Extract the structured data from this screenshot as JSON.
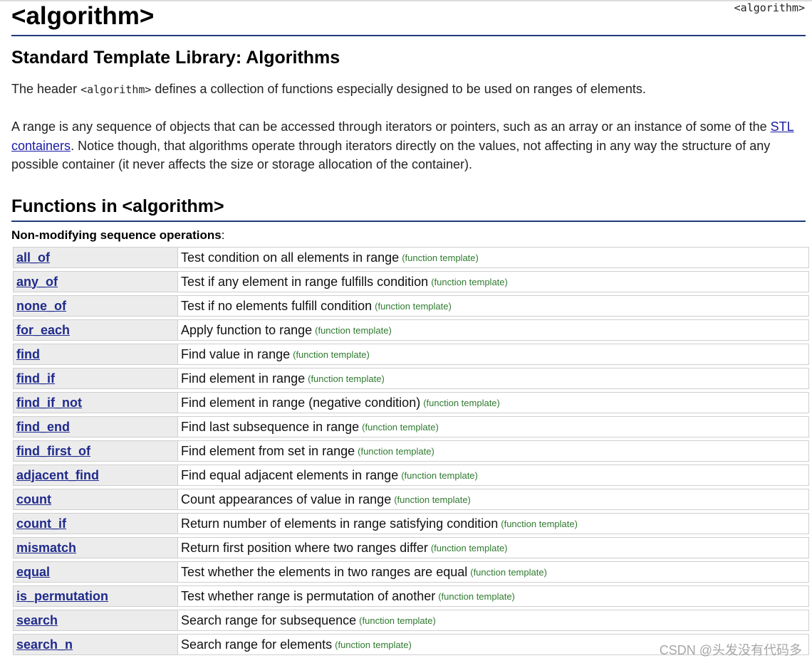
{
  "header": {
    "title": "<algorithm>",
    "badge": "<algorithm>"
  },
  "intro": {
    "subtitle": "Standard Template Library: Algorithms",
    "p1_before": "The header ",
    "p1_code": "<algorithm>",
    "p1_after": " defines a collection of functions especially designed to be used on ranges of elements.",
    "p2_before": "A range is any sequence of objects that can be accessed through iterators or pointers, such as an array or an instance of some of the ",
    "p2_link": "STL containers",
    "p2_after": ". Notice though, that algorithms operate through iterators directly on the values, not affecting in any way the structure of any possible container (it never affects the size or storage allocation of the container)."
  },
  "functions": {
    "section_title": "Functions in <algorithm>",
    "group_label": "Non-modifying sequence operations",
    "group_suffix": ":",
    "rows": [
      {
        "name": "all_of",
        "desc": "Test condition on all elements in range",
        "kind": "(function template)"
      },
      {
        "name": "any_of",
        "desc": "Test if any element in range fulfills condition",
        "kind": "(function template)"
      },
      {
        "name": "none_of",
        "desc": "Test if no elements fulfill condition",
        "kind": "(function template)"
      },
      {
        "name": "for_each",
        "desc": "Apply function to range",
        "kind": "(function template)"
      },
      {
        "name": "find",
        "desc": "Find value in range",
        "kind": "(function template)"
      },
      {
        "name": "find_if",
        "desc": "Find element in range",
        "kind": "(function template)"
      },
      {
        "name": "find_if_not",
        "desc": "Find element in range (negative condition)",
        "kind": "(function template)"
      },
      {
        "name": "find_end",
        "desc": "Find last subsequence in range",
        "kind": "(function template)"
      },
      {
        "name": "find_first_of",
        "desc": "Find element from set in range",
        "kind": "(function template)"
      },
      {
        "name": "adjacent_find",
        "desc": "Find equal adjacent elements in range",
        "kind": "(function template)"
      },
      {
        "name": "count",
        "desc": "Count appearances of value in range",
        "kind": "(function template)"
      },
      {
        "name": "count_if",
        "desc": "Return number of elements in range satisfying condition",
        "kind": "(function template)"
      },
      {
        "name": "mismatch",
        "desc": "Return first position where two ranges differ",
        "kind": "(function template)"
      },
      {
        "name": "equal",
        "desc": "Test whether the elements in two ranges are equal",
        "kind": "(function template)"
      },
      {
        "name": "is_permutation",
        "desc": "Test whether range is permutation of another",
        "kind": "(function template)"
      },
      {
        "name": "search",
        "desc": "Search range for subsequence",
        "kind": "(function template)"
      },
      {
        "name": "search_n",
        "desc": "Search range for elements",
        "kind": "(function template)"
      }
    ]
  },
  "watermark": "CSDN @头发没有代码多",
  "colors": {
    "link": "#1f2a8c",
    "rule": "#1f3a7a",
    "kind": "#2f7a2f",
    "name_cell_bg": "#ececec"
  }
}
